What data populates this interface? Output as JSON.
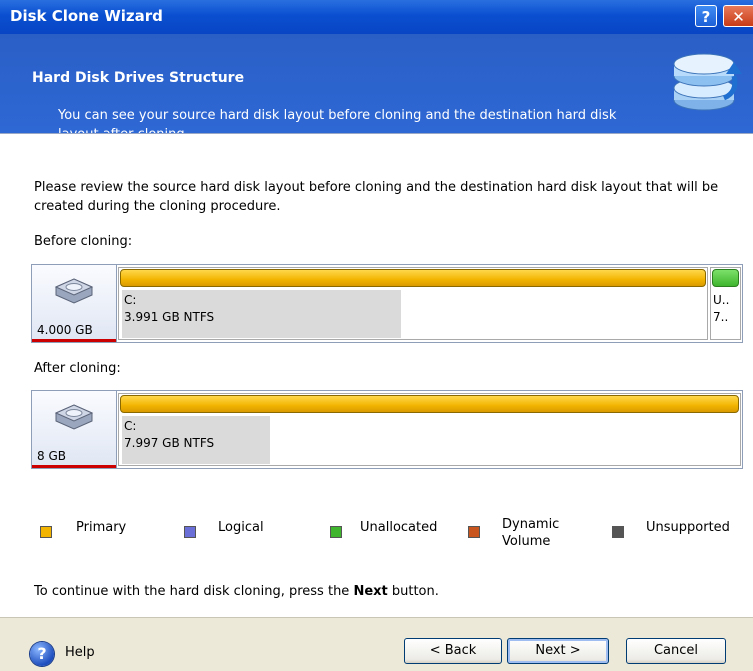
{
  "window": {
    "title": "Disk Clone Wizard",
    "help_button": "?",
    "close_button": "✕"
  },
  "header": {
    "title": "Hard Disk Drives Structure",
    "description": "You can see your source hard disk layout before cloning and the destination hard disk layout after cloning."
  },
  "intro": "Please review the source hard disk layout before cloning and the destination hard disk layout that will be created during the cloning procedure.",
  "before": {
    "label": "Before cloning:",
    "disk_size": "4.000 GB",
    "partitions": [
      {
        "name": "C:",
        "info": "3.991 GB  NTFS",
        "type": "Primary",
        "used_fraction": 0.48
      },
      {
        "name": "U..",
        "info": "7..",
        "type": "Unallocated"
      }
    ]
  },
  "after": {
    "label": "After cloning:",
    "disk_size": "8 GB",
    "partitions": [
      {
        "name": "C:",
        "info": "7.997 GB  NTFS",
        "type": "Primary",
        "used_fraction": 0.24
      }
    ]
  },
  "legend": [
    {
      "label": "Primary",
      "color": "#f2b400"
    },
    {
      "label": "Logical",
      "color": "#6a6fd8"
    },
    {
      "label": "Unallocated",
      "color": "#3fb52d"
    },
    {
      "label": "Dynamic Volume",
      "color": "#c8551e"
    },
    {
      "label": "Unsupported",
      "color": "#555555"
    }
  ],
  "footer_hint": {
    "prefix": "To continue with the hard disk cloning, press the ",
    "bold": "Next",
    "suffix": " button."
  },
  "buttons": {
    "help": "Help",
    "back": "< Back",
    "next": "Next >",
    "cancel": "Cancel"
  },
  "icons": {
    "header": "disks-clone-icon",
    "disk": "hard-disk-icon",
    "help": "help-icon"
  }
}
